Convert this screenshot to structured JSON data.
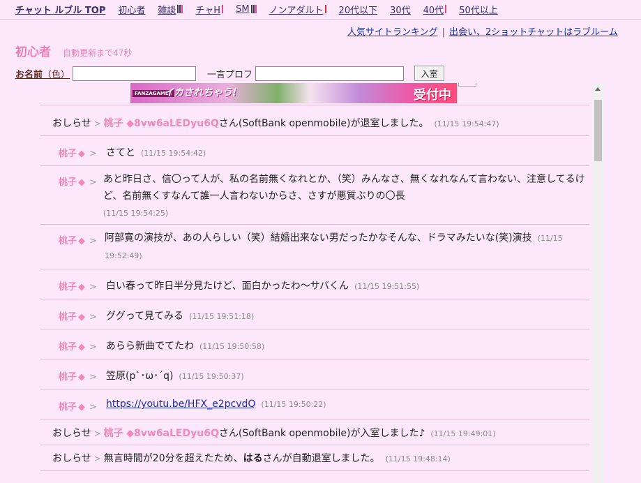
{
  "nav": {
    "items": [
      {
        "label": "チャット ルブル TOP",
        "bars": []
      },
      {
        "label": "初心者",
        "bars": []
      },
      {
        "label": "雑談",
        "bars": [
          "#333",
          "#3a2f6b",
          "#e04a8a"
        ]
      },
      {
        "label": "チャH",
        "bars": [
          "#e04a8a"
        ]
      },
      {
        "label": "SM",
        "bars": [
          "#333",
          "#3a2f6b",
          "#e04a8a"
        ]
      },
      {
        "label": "ノンアダルト",
        "bars": [
          "#e03030"
        ]
      },
      {
        "label": "20代以下",
        "bars": []
      },
      {
        "label": "30代",
        "bars": []
      },
      {
        "label": "40代",
        "bars": [
          "#e04a8a"
        ]
      },
      {
        "label": "50代以上",
        "bars": []
      }
    ]
  },
  "rightlinks": {
    "ranking": "人気サイトランキング",
    "separator": "|",
    "promo": "出会い、2ショットチャットはラブルーム"
  },
  "room": {
    "name": "初心者",
    "timer": "自動更新まで47秒"
  },
  "form": {
    "name_label": "お名前",
    "color_label": "（色）",
    "prof_label": "一言プロフ",
    "enter_label": "入室",
    "name_value": "",
    "prof_value": ""
  },
  "banner": {
    "logo": "FANZAGAMES",
    "left": "イカされちゃう!",
    "right": "受付中"
  },
  "log": [
    {
      "kind": "system",
      "label": "おしらせ",
      "arrow": ">",
      "who": "桃子",
      "trip": "◆8vw6aLEDyu6Q",
      "text": "さん(SoftBank openmobile)が退室しました。",
      "ts": "(11/15 19:54:47)"
    },
    {
      "kind": "msg",
      "speaker": "桃子",
      "dia": "◆",
      "arrow": ">",
      "text": "さてと",
      "ts": "(11/15 19:54:42)"
    },
    {
      "kind": "multi",
      "speaker": "桃子",
      "dia": "◆",
      "arrow": ">",
      "text": "あと昨日さ、信〇って人が、私の名前無くなれとか、（笑）みんなさ、無くなれなんて言わない、注意してるけど、名前無くすなんて誰一人言わないからさ、さすが悪質ぶりの〇長",
      "ts": "(11/15 19:54:25)"
    },
    {
      "kind": "multi",
      "speaker": "桃子",
      "dia": "◆",
      "arrow": ">",
      "text": "阿部寛の演技が、あの人らしい（笑）結婚出来ない男だったかなそんな、ドラマみたいな(笑)演技",
      "ts": "(11/15 19:52:49)"
    },
    {
      "kind": "msg",
      "speaker": "桃子",
      "dia": "◆",
      "arrow": ">",
      "text": "白い春って昨日半分見たけど、面白かったわ～サバくん",
      "ts": "(11/15 19:51:55)"
    },
    {
      "kind": "msg",
      "speaker": "桃子",
      "dia": "◆",
      "arrow": ">",
      "text": "ググって見てみる",
      "ts": "(11/15 19:51:18)"
    },
    {
      "kind": "msg",
      "speaker": "桃子",
      "dia": "◆",
      "arrow": ">",
      "text": "あらら新曲でてたわ",
      "ts": "(11/15 19:50:58)"
    },
    {
      "kind": "msg",
      "speaker": "桃子",
      "dia": "◆",
      "arrow": ">",
      "text": "笠原(p`･ω･´q)",
      "ts": "(11/15 19:50:37)"
    },
    {
      "kind": "link",
      "speaker": "桃子",
      "dia": "◆",
      "arrow": ">",
      "text": "https://youtu.be/HFX_e2pcvdQ",
      "ts": "(11/15 19:50:22)"
    },
    {
      "kind": "system",
      "label": "おしらせ",
      "arrow": ">",
      "who": "桃子",
      "trip": "◆8vw6aLEDyu6Q",
      "text": "さん(SoftBank openmobile)が入室しました♪",
      "ts": "(11/15 19:49:01)"
    },
    {
      "kind": "system2",
      "label": "おしらせ",
      "arrow": ">",
      "pre": "無言時間が20分を超えたため、",
      "who": "はる",
      "text": "さんが自動退室しました。",
      "ts": "(11/15 19:48:14)"
    }
  ]
}
